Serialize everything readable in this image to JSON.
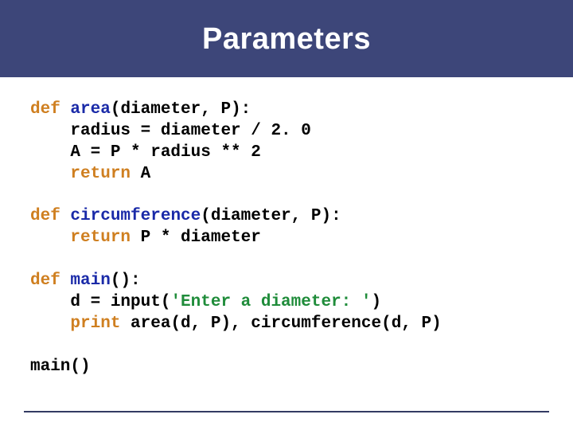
{
  "header": {
    "title": "Parameters"
  },
  "code": {
    "l01_kw": "def",
    "l01_name": "area",
    "l01_rest": "(diameter, P):",
    "l02": "    radius = diameter / 2. 0",
    "l03": "    A = P * radius ** 2",
    "l04_pre": "    ",
    "l04_kw": "return",
    "l04_post": " A",
    "l06_kw": "def",
    "l06_name": "circumference",
    "l06_rest": "(diameter, P):",
    "l07_pre": "    ",
    "l07_kw": "return",
    "l07_post": " P * diameter",
    "l09_kw": "def",
    "l09_name": "main",
    "l09_rest": "():",
    "l10_pre": "    d = input(",
    "l10_str": "'Enter a diameter: '",
    "l10_post": ")",
    "l11_pre": "    ",
    "l11_kw": "print",
    "l11_post": " area(d, P), circumference(d, P)",
    "l13": "main()"
  }
}
